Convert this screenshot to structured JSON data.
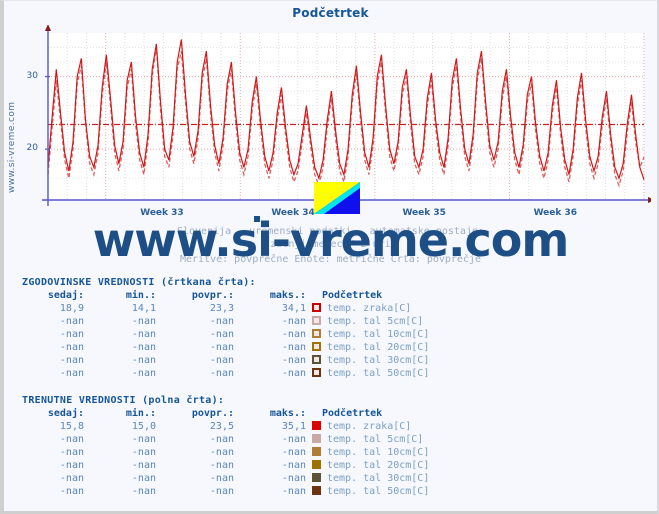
{
  "page": {
    "background": "#f7f8fd",
    "vertical_watermark": "www.si-vreme.com",
    "watermark": "www.si-vreme.com"
  },
  "header": {
    "title": "Podčetrtek"
  },
  "subtitle": {
    "line1": "Slovenija - vremenski podatki - avtomatske postaje:",
    "line2": "zadnji mesec / 2 uri",
    "line3": "Meritve: povprečne  Enote: metrične  Črta: povprečje"
  },
  "chart_data": {
    "type": "line",
    "title": "Podčetrtek",
    "xlabel": "",
    "ylabel": "",
    "ylim": [
      13,
      36
    ],
    "yticks": [
      20,
      30
    ],
    "ytick_labels": [
      "20",
      "30"
    ],
    "xtick_labels": [
      "Week 33",
      "Week 34",
      "Week 35",
      "Week 36"
    ],
    "xtick_positions_frac": [
      0.195,
      0.415,
      0.635,
      0.855
    ],
    "grid": true,
    "legend_position": "below-table",
    "average_line": 23.4,
    "average_line_color": "#cc2222",
    "series": [
      {
        "name": "temp. zraka[C] (trenutne / polna črta)",
        "style": "solid",
        "color": "#d01818",
        "now": 15.8,
        "min": 15.0,
        "avg": 23.5,
        "max": 35.1,
        "values": [
          17.5,
          24.5,
          31.0,
          25.0,
          19.5,
          17.0,
          21.0,
          30.0,
          32.5,
          24.0,
          19.0,
          17.5,
          20.5,
          28.5,
          33.0,
          27.0,
          20.5,
          18.0,
          21.0,
          29.5,
          32.0,
          24.5,
          19.5,
          17.5,
          22.0,
          31.0,
          34.5,
          26.5,
          20.0,
          18.5,
          23.0,
          32.0,
          35.1,
          27.5,
          21.0,
          19.0,
          22.5,
          30.5,
          33.5,
          26.0,
          20.5,
          18.0,
          21.5,
          29.0,
          32.0,
          25.0,
          19.5,
          17.5,
          20.0,
          26.5,
          30.0,
          24.0,
          19.0,
          17.0,
          19.5,
          25.0,
          28.5,
          23.0,
          18.5,
          16.5,
          18.0,
          22.0,
          26.0,
          21.5,
          17.5,
          16.0,
          18.5,
          24.0,
          28.0,
          22.5,
          18.0,
          16.5,
          20.0,
          27.5,
          31.5,
          25.0,
          19.5,
          17.5,
          21.5,
          30.0,
          33.0,
          26.0,
          20.0,
          18.0,
          21.0,
          28.5,
          31.0,
          24.5,
          19.0,
          17.5,
          20.0,
          27.0,
          30.5,
          24.0,
          19.5,
          17.5,
          21.5,
          29.5,
          32.5,
          25.5,
          20.0,
          18.0,
          22.0,
          30.5,
          33.5,
          26.5,
          20.5,
          18.5,
          21.0,
          28.0,
          31.0,
          24.5,
          19.5,
          17.5,
          20.5,
          27.5,
          30.0,
          23.5,
          19.0,
          17.0,
          19.5,
          26.0,
          29.5,
          23.0,
          18.5,
          16.5,
          20.0,
          27.0,
          30.5,
          24.0,
          19.0,
          17.0,
          19.0,
          24.5,
          28.0,
          22.0,
          17.5,
          16.0,
          18.0,
          23.5,
          27.5,
          22.0,
          17.5,
          15.8
        ]
      },
      {
        "name": "temp. zraka[C] (zgodovinske / črtkana črta)",
        "style": "dashed",
        "color": "#e05c5c",
        "now": 18.9,
        "min": 14.1,
        "avg": 23.3,
        "max": 34.1,
        "values": [
          16.5,
          23.0,
          29.5,
          24.0,
          18.5,
          16.0,
          20.0,
          29.0,
          31.5,
          23.5,
          18.0,
          16.5,
          19.5,
          27.5,
          32.0,
          26.0,
          19.5,
          17.0,
          20.0,
          28.5,
          31.0,
          23.5,
          18.5,
          16.5,
          21.0,
          30.0,
          34.1,
          25.5,
          19.0,
          17.5,
          22.0,
          31.0,
          33.5,
          26.5,
          20.0,
          18.0,
          21.5,
          29.5,
          32.5,
          25.0,
          19.5,
          17.0,
          20.5,
          28.0,
          31.0,
          24.0,
          18.5,
          16.5,
          19.0,
          25.5,
          29.0,
          23.0,
          18.0,
          16.0,
          18.5,
          24.0,
          27.5,
          22.0,
          17.5,
          15.5,
          17.0,
          21.0,
          25.0,
          20.5,
          16.5,
          15.0,
          17.5,
          23.0,
          27.0,
          21.5,
          17.0,
          15.5,
          19.0,
          26.5,
          30.5,
          24.0,
          18.5,
          16.5,
          20.5,
          29.0,
          32.0,
          25.0,
          19.0,
          17.0,
          20.0,
          27.5,
          30.0,
          23.5,
          18.0,
          16.5,
          19.0,
          26.0,
          29.5,
          23.0,
          18.5,
          16.5,
          20.5,
          28.5,
          31.5,
          24.5,
          19.0,
          17.0,
          21.0,
          29.5,
          32.5,
          25.5,
          19.5,
          17.5,
          20.0,
          27.0,
          30.0,
          23.5,
          18.5,
          16.5,
          19.5,
          26.5,
          29.0,
          22.5,
          18.0,
          16.0,
          18.5,
          25.0,
          28.5,
          22.0,
          17.5,
          15.5,
          19.0,
          26.0,
          29.5,
          23.0,
          18.0,
          16.0,
          18.0,
          23.5,
          27.0,
          21.0,
          16.5,
          15.0,
          17.0,
          22.5,
          26.5,
          21.0,
          17.5,
          18.9
        ]
      }
    ]
  },
  "tables": [
    {
      "id": "historical",
      "caption": "ZGODOVINSKE VREDNOSTI (črtkana črta):",
      "swatch_style": "hollow",
      "columns": [
        "sedaj:",
        "min.:",
        "povpr.:",
        "maks.:",
        "Podčetrtek"
      ],
      "rows": [
        {
          "sedaj": "18,9",
          "min": "14,1",
          "povpr": "23,3",
          "maks": "34,1",
          "label": "temp. zraka[C]",
          "color": "#cc0000"
        },
        {
          "sedaj": "-nan",
          "min": "-nan",
          "povpr": "-nan",
          "maks": "-nan",
          "label": "temp. tal  5cm[C]",
          "color": "#c9a9a6"
        },
        {
          "sedaj": "-nan",
          "min": "-nan",
          "povpr": "-nan",
          "maks": "-nan",
          "label": "temp. tal 10cm[C]",
          "color": "#b07d35"
        },
        {
          "sedaj": "-nan",
          "min": "-nan",
          "povpr": "-nan",
          "maks": "-nan",
          "label": "temp. tal 20cm[C]",
          "color": "#a07000"
        },
        {
          "sedaj": "-nan",
          "min": "-nan",
          "povpr": "-nan",
          "maks": "-nan",
          "label": "temp. tal 30cm[C]",
          "color": "#5b5237"
        },
        {
          "sedaj": "-nan",
          "min": "-nan",
          "povpr": "-nan",
          "maks": "-nan",
          "label": "temp. tal 50cm[C]",
          "color": "#6b3410"
        }
      ]
    },
    {
      "id": "current",
      "caption": "TRENUTNE VREDNOSTI (polna črta):",
      "swatch_style": "solid",
      "columns": [
        "sedaj:",
        "min.:",
        "povpr.:",
        "maks.:",
        "Podčetrtek"
      ],
      "rows": [
        {
          "sedaj": "15,8",
          "min": "15,0",
          "povpr": "23,5",
          "maks": "35,1",
          "label": "temp. zraka[C]",
          "color": "#dd0000"
        },
        {
          "sedaj": "-nan",
          "min": "-nan",
          "povpr": "-nan",
          "maks": "-nan",
          "label": "temp. tal  5cm[C]",
          "color": "#c9a9a6"
        },
        {
          "sedaj": "-nan",
          "min": "-nan",
          "povpr": "-nan",
          "maks": "-nan",
          "label": "temp. tal 10cm[C]",
          "color": "#b07d35"
        },
        {
          "sedaj": "-nan",
          "min": "-nan",
          "povpr": "-nan",
          "maks": "-nan",
          "label": "temp. tal 20cm[C]",
          "color": "#a07000"
        },
        {
          "sedaj": "-nan",
          "min": "-nan",
          "povpr": "-nan",
          "maks": "-nan",
          "label": "temp. tal 30cm[C]",
          "color": "#5b5237"
        },
        {
          "sedaj": "-nan",
          "min": "-nan",
          "povpr": "-nan",
          "maks": "-nan",
          "label": "temp. tal 50cm[C]",
          "color": "#6b3410"
        }
      ]
    }
  ],
  "logo": {
    "name": "si-vreme-logo",
    "colors": [
      "#ffff00",
      "#00e5ee",
      "#1010ee"
    ]
  }
}
